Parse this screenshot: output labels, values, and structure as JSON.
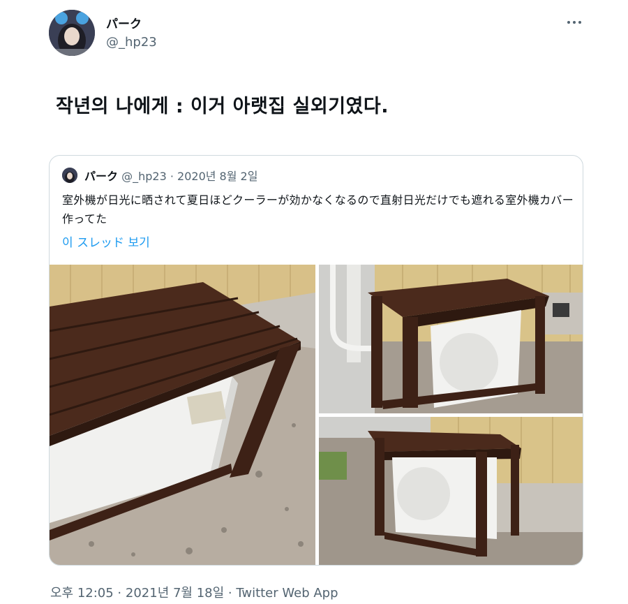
{
  "author": {
    "name": "パーク",
    "handle": "@_hp23",
    "more_icon": "more-horizontal-icon"
  },
  "tweet": {
    "text": "작년의 나에게 : 이거 아랫집 실외기였다."
  },
  "quoted_tweet": {
    "name": "パーク",
    "handle": "@_hp23",
    "date": "2020년 8월 2일",
    "text": "室外機が日光に晒されて夏日ほどクーラーが効かなくなるので直射日光だけでも遮れる室外機カバー作ってた",
    "thread_link": "이 スレッド 보기"
  },
  "footer": {
    "timestamp": "오후 12:05 · 2021년 7월 18일 · Twitter Web App"
  },
  "colors": {
    "link": "#1d9bf0",
    "secondary_text": "#536471",
    "border": "#cfd9de"
  }
}
